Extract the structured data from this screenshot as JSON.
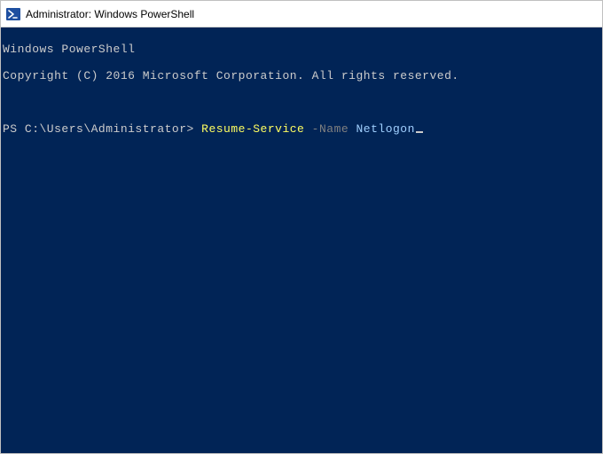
{
  "window": {
    "title": "Administrator: Windows PowerShell",
    "icon_name": "powershell-icon"
  },
  "terminal": {
    "banner_line1": "Windows PowerShell",
    "banner_line2": "Copyright (C) 2016 Microsoft Corporation. All rights reserved.",
    "prompt": "PS C:\\Users\\Administrator> ",
    "command": {
      "cmdlet": "Resume-Service",
      "param": "-Name",
      "arg": "Netlogon"
    }
  },
  "colors": {
    "background": "#012456",
    "foreground": "#cccccc",
    "cmdlet": "#ffff60",
    "param": "#808080",
    "arg": "#a0d0ff"
  }
}
